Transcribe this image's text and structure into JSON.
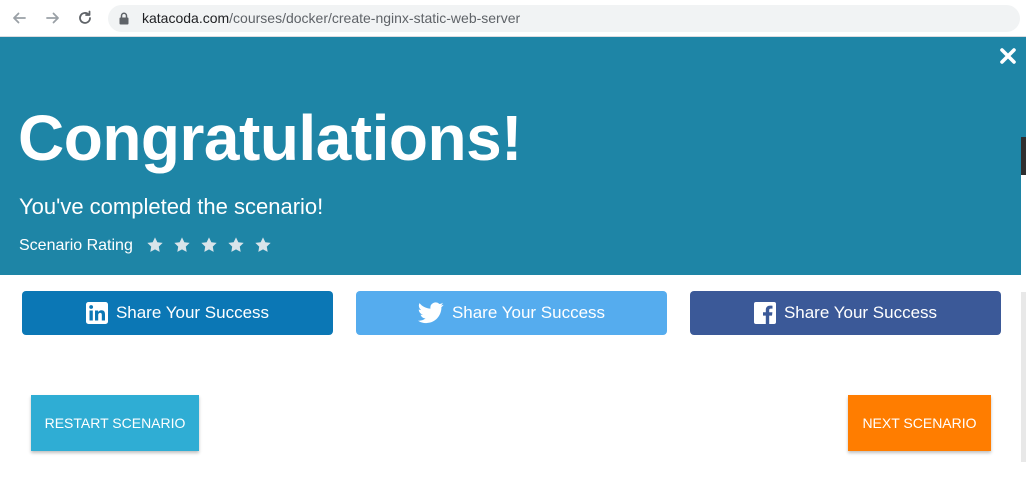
{
  "browser": {
    "url_host": "katacoda.com",
    "url_path": "/courses/docker/create-nginx-static-web-server",
    "back_icon": "arrow-left-icon",
    "forward_icon": "arrow-right-icon",
    "reload_icon": "reload-icon",
    "lock_icon": "lock-icon"
  },
  "banner": {
    "title": "Congratulations!",
    "subtitle": "You've completed the scenario!",
    "rating_label": "Scenario Rating",
    "stars": 5,
    "close_icon": "close-icon",
    "background": "#1e85a6"
  },
  "share": {
    "linkedin": {
      "label": "Share Your Success",
      "icon": "linkedin-icon",
      "color": "#0b77b5"
    },
    "twitter": {
      "label": "Share Your Success",
      "icon": "twitter-icon",
      "color": "#55acee"
    },
    "facebook": {
      "label": "Share Your Success",
      "icon": "facebook-icon",
      "color": "#3b5998"
    }
  },
  "actions": {
    "restart_label": "RESTART SCENARIO",
    "restart_color": "#2fadd4",
    "next_label": "NEXT SCENARIO",
    "next_color": "#ff7d00"
  }
}
